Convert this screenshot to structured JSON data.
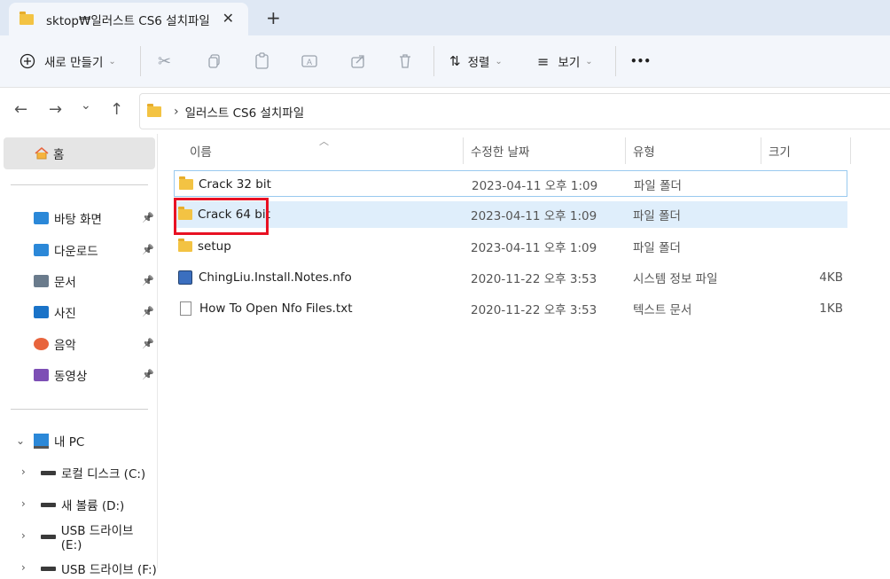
{
  "tab": {
    "title": "sktop₩일러스트 CS6 설치파일",
    "close": "✕",
    "new": "+"
  },
  "toolbar": {
    "new_label": "새로 만들기",
    "new_icon": "plus-circle-icon",
    "sort_label": "정렬",
    "view_label": "보기",
    "more_label": "•••",
    "icons": [
      "cut-icon",
      "copy-icon",
      "paste-icon",
      "rename-icon",
      "share-icon",
      "delete-icon"
    ]
  },
  "nav": {
    "back": "←",
    "forward": "→",
    "recent": "⌄",
    "up": "↑"
  },
  "address": {
    "separator": "›",
    "crumb": "일러스트 CS6 설치파일"
  },
  "sidebar": {
    "home": "홈",
    "quick": [
      {
        "label": "바탕 화면",
        "icon": "desktop-icon",
        "color": "#2b88d8"
      },
      {
        "label": "다운로드",
        "icon": "download-icon",
        "color": "#2b88d8"
      },
      {
        "label": "문서",
        "icon": "document-icon",
        "color": "#6a7b8c"
      },
      {
        "label": "사진",
        "icon": "pictures-icon",
        "color": "#1a73c8"
      },
      {
        "label": "음악",
        "icon": "music-icon",
        "color": "#e8643c"
      },
      {
        "label": "동영상",
        "icon": "video-icon",
        "color": "#7d4fb5"
      }
    ],
    "pc": "내 PC",
    "drives": [
      "로컬 디스크 (C:)",
      "새 볼륨 (D:)",
      "USB 드라이브 (E:)",
      "USB 드라이브 (F:)"
    ]
  },
  "columns": {
    "name": "이름",
    "date": "수정한 날짜",
    "type": "유형",
    "size": "크기"
  },
  "files": [
    {
      "name": "Crack 32 bit",
      "date": "2023-04-11 오후 1:09",
      "type": "파일 폴더",
      "size": "",
      "icon": "folder-icon"
    },
    {
      "name": "Crack 64 bit",
      "date": "2023-04-11 오후 1:09",
      "type": "파일 폴더",
      "size": "",
      "icon": "folder-icon"
    },
    {
      "name": "setup",
      "date": "2023-04-11 오후 1:09",
      "type": "파일 폴더",
      "size": "",
      "icon": "folder-icon"
    },
    {
      "name": "ChingLiu.Install.Notes.nfo",
      "date": "2020-11-22 오후 3:53",
      "type": "시스템 정보 파일",
      "size": "4KB",
      "icon": "system-info-icon"
    },
    {
      "name": "How To Open Nfo Files.txt",
      "date": "2020-11-22 오후 3:53",
      "type": "텍스트 문서",
      "size": "1KB",
      "icon": "text-file-icon"
    }
  ],
  "colors": {
    "accent": "#2b88d8",
    "highlight": "#dfeefb",
    "annotation": "#e81123"
  }
}
